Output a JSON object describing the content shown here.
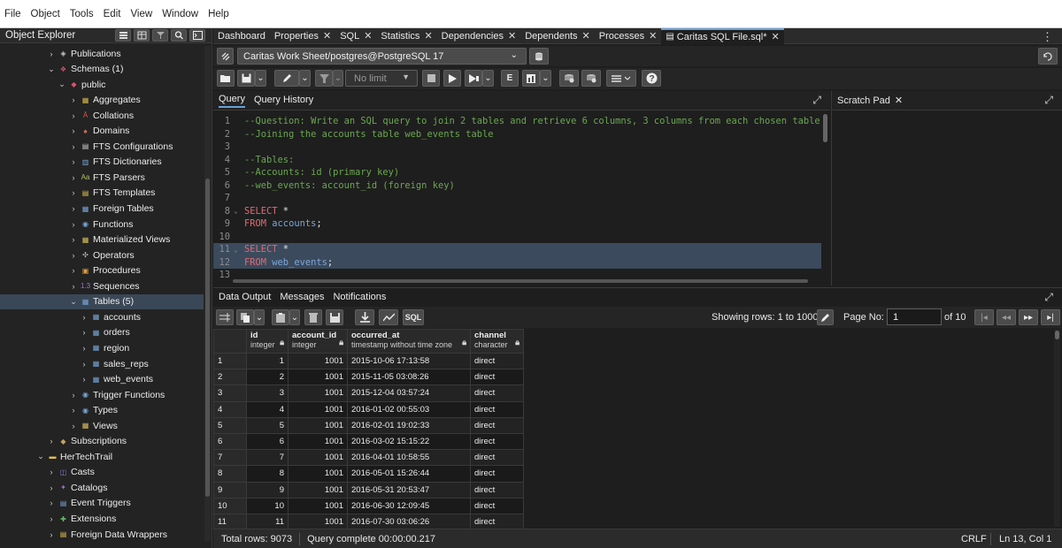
{
  "menu": [
    "File",
    "Object",
    "Tools",
    "Edit",
    "View",
    "Window",
    "Help"
  ],
  "explorer": {
    "title": "Object Explorer",
    "nodes": [
      {
        "label": "Publications",
        "icon": "publications-icon",
        "color": "#c9c9c9"
      },
      {
        "label": "Schemas (1)",
        "icon": "schemas-icon",
        "color": "#e0506a"
      },
      {
        "label": "public",
        "icon": "schema-icon",
        "color": "#e0506a"
      },
      {
        "label": "Aggregates",
        "icon": "aggregates-icon",
        "color": "#d9b84a"
      },
      {
        "label": "Collations",
        "icon": "collations-icon",
        "color": "#e05050"
      },
      {
        "label": "Domains",
        "icon": "domains-icon",
        "color": "#e07050"
      },
      {
        "label": "FTS Configurations",
        "icon": "fts-configurations-icon",
        "color": "#cfcfcf"
      },
      {
        "label": "FTS Dictionaries",
        "icon": "fts-dictionaries-icon",
        "color": "#7aa6d9"
      },
      {
        "label": "FTS Parsers",
        "icon": "fts-parsers-icon",
        "color": "#b0c060"
      },
      {
        "label": "FTS Templates",
        "icon": "fts-templates-icon",
        "color": "#e0c050"
      },
      {
        "label": "Foreign Tables",
        "icon": "foreign-tables-icon",
        "color": "#7aa6d9"
      },
      {
        "label": "Functions",
        "icon": "functions-icon",
        "color": "#7aa6d9"
      },
      {
        "label": "Materialized Views",
        "icon": "materialized-views-icon",
        "color": "#d9c060"
      },
      {
        "label": "Operators",
        "icon": "operators-icon",
        "color": "#c0c0c0"
      },
      {
        "label": "Procedures",
        "icon": "procedures-icon",
        "color": "#e0a040"
      },
      {
        "label": "Sequences",
        "icon": "sequences-icon",
        "color": "#a070d0"
      },
      {
        "label": "Tables (5)",
        "icon": "tables-icon",
        "color": "#7aa6d9"
      },
      {
        "label": "accounts",
        "icon": "table-icon",
        "color": "#7aa6d9"
      },
      {
        "label": "orders",
        "icon": "table-icon",
        "color": "#7aa6d9"
      },
      {
        "label": "region",
        "icon": "table-icon",
        "color": "#7aa6d9"
      },
      {
        "label": "sales_reps",
        "icon": "table-icon",
        "color": "#7aa6d9"
      },
      {
        "label": "web_events",
        "icon": "table-icon",
        "color": "#7aa6d9"
      },
      {
        "label": "Trigger Functions",
        "icon": "trigger-functions-icon",
        "color": "#7aa6d9"
      },
      {
        "label": "Types",
        "icon": "types-icon",
        "color": "#7aa6d9"
      },
      {
        "label": "Views",
        "icon": "views-icon",
        "color": "#d9c060"
      },
      {
        "label": "Subscriptions",
        "icon": "subscriptions-icon",
        "color": "#c9a060"
      },
      {
        "label": "HerTechTrail",
        "icon": "database-icon",
        "color": "#e0c050"
      },
      {
        "label": "Casts",
        "icon": "casts-icon",
        "color": "#8080e0"
      },
      {
        "label": "Catalogs",
        "icon": "catalogs-icon",
        "color": "#a070d0"
      },
      {
        "label": "Event Triggers",
        "icon": "event-triggers-icon",
        "color": "#7aa6d9"
      },
      {
        "label": "Extensions",
        "icon": "extensions-icon",
        "color": "#60c060"
      },
      {
        "label": "Foreign Data Wrappers",
        "icon": "foreign-data-wrappers-icon",
        "color": "#e0c050"
      }
    ]
  },
  "tabs": [
    {
      "label": "Dashboard",
      "closable": false
    },
    {
      "label": "Properties",
      "closable": true
    },
    {
      "label": "SQL",
      "closable": true
    },
    {
      "label": "Statistics",
      "closable": true
    },
    {
      "label": "Dependencies",
      "closable": true
    },
    {
      "label": "Dependents",
      "closable": true
    },
    {
      "label": "Processes",
      "closable": true
    },
    {
      "label": "Caritas SQL File.sql*",
      "closable": true,
      "active": true
    }
  ],
  "connection": {
    "label": "Caritas Work Sheet/postgres@PostgreSQL 17"
  },
  "toolbar": {
    "limit_placeholder": "No limit"
  },
  "query": {
    "tabs": [
      "Query",
      "Query History"
    ],
    "lines": [
      {
        "n": "1",
        "text": "--Question: Write an SQL query to join 2 tables and retrieve 6 columns, 3 columns from each chosen table",
        "kind": "comment"
      },
      {
        "n": "2",
        "text": "--Joining the accounts table web_events table",
        "kind": "comment"
      },
      {
        "n": "3",
        "text": "",
        "kind": "plain"
      },
      {
        "n": "4",
        "text": "--Tables:",
        "kind": "comment"
      },
      {
        "n": "5",
        "text": "--Accounts: id (primary key)",
        "kind": "comment"
      },
      {
        "n": "6",
        "text": "--web_events: account_id (foreign key)",
        "kind": "comment"
      },
      {
        "n": "7",
        "text": "",
        "kind": "plain"
      },
      {
        "n": "8",
        "kw": "SELECT",
        "rest": " *",
        "kind": "select",
        "fold": true
      },
      {
        "n": "9",
        "kw": "FROM",
        "id": "accounts",
        "end": ";",
        "kind": "from"
      },
      {
        "n": "10",
        "text": "",
        "kind": "plain"
      },
      {
        "n": "11",
        "kw": "SELECT",
        "rest": " *",
        "kind": "select",
        "fold": true,
        "selected": true
      },
      {
        "n": "12",
        "kw": "FROM",
        "id": "web_events",
        "end": ";",
        "kind": "from",
        "selected": true
      },
      {
        "n": "13",
        "text": "",
        "kind": "plain"
      }
    ]
  },
  "scratch": {
    "title": "Scratch Pad"
  },
  "output": {
    "tabs": [
      "Data Output",
      "Messages",
      "Notifications"
    ],
    "showing": "Showing rows: 1 to 1000",
    "page_label": "Page No:",
    "page_value": "1",
    "page_of": "of 10",
    "columns": [
      {
        "name": "id",
        "type": "integer"
      },
      {
        "name": "account_id",
        "type": "integer"
      },
      {
        "name": "occurred_at",
        "type": "timestamp without time zone"
      },
      {
        "name": "channel",
        "type": "character"
      }
    ],
    "rows": [
      [
        "1",
        "1",
        "1001",
        "2015-10-06 17:13:58",
        "direct"
      ],
      [
        "2",
        "2",
        "1001",
        "2015-11-05 03:08:26",
        "direct"
      ],
      [
        "3",
        "3",
        "1001",
        "2015-12-04 03:57:24",
        "direct"
      ],
      [
        "4",
        "4",
        "1001",
        "2016-01-02 00:55:03",
        "direct"
      ],
      [
        "5",
        "5",
        "1001",
        "2016-02-01 19:02:33",
        "direct"
      ],
      [
        "6",
        "6",
        "1001",
        "2016-03-02 15:15:22",
        "direct"
      ],
      [
        "7",
        "7",
        "1001",
        "2016-04-01 10:58:55",
        "direct"
      ],
      [
        "8",
        "8",
        "1001",
        "2016-05-01 15:26:44",
        "direct"
      ],
      [
        "9",
        "9",
        "1001",
        "2016-05-31 20:53:47",
        "direct"
      ],
      [
        "10",
        "10",
        "1001",
        "2016-06-30 12:09:45",
        "direct"
      ],
      [
        "11",
        "11",
        "1001",
        "2016-07-30 03:06:26",
        "direct"
      ]
    ]
  },
  "status": {
    "total_rows": "Total rows: 9073",
    "query_complete": "Query complete 00:00:00.217",
    "eol": "CRLF",
    "position": "Ln 13, Col 1"
  },
  "colors": {
    "accent": "#6aa0d8",
    "selection": "#3b4a5c",
    "keyword": "#e06c75",
    "comment": "#6aa84f",
    "identifier": "#7aa6d9"
  }
}
